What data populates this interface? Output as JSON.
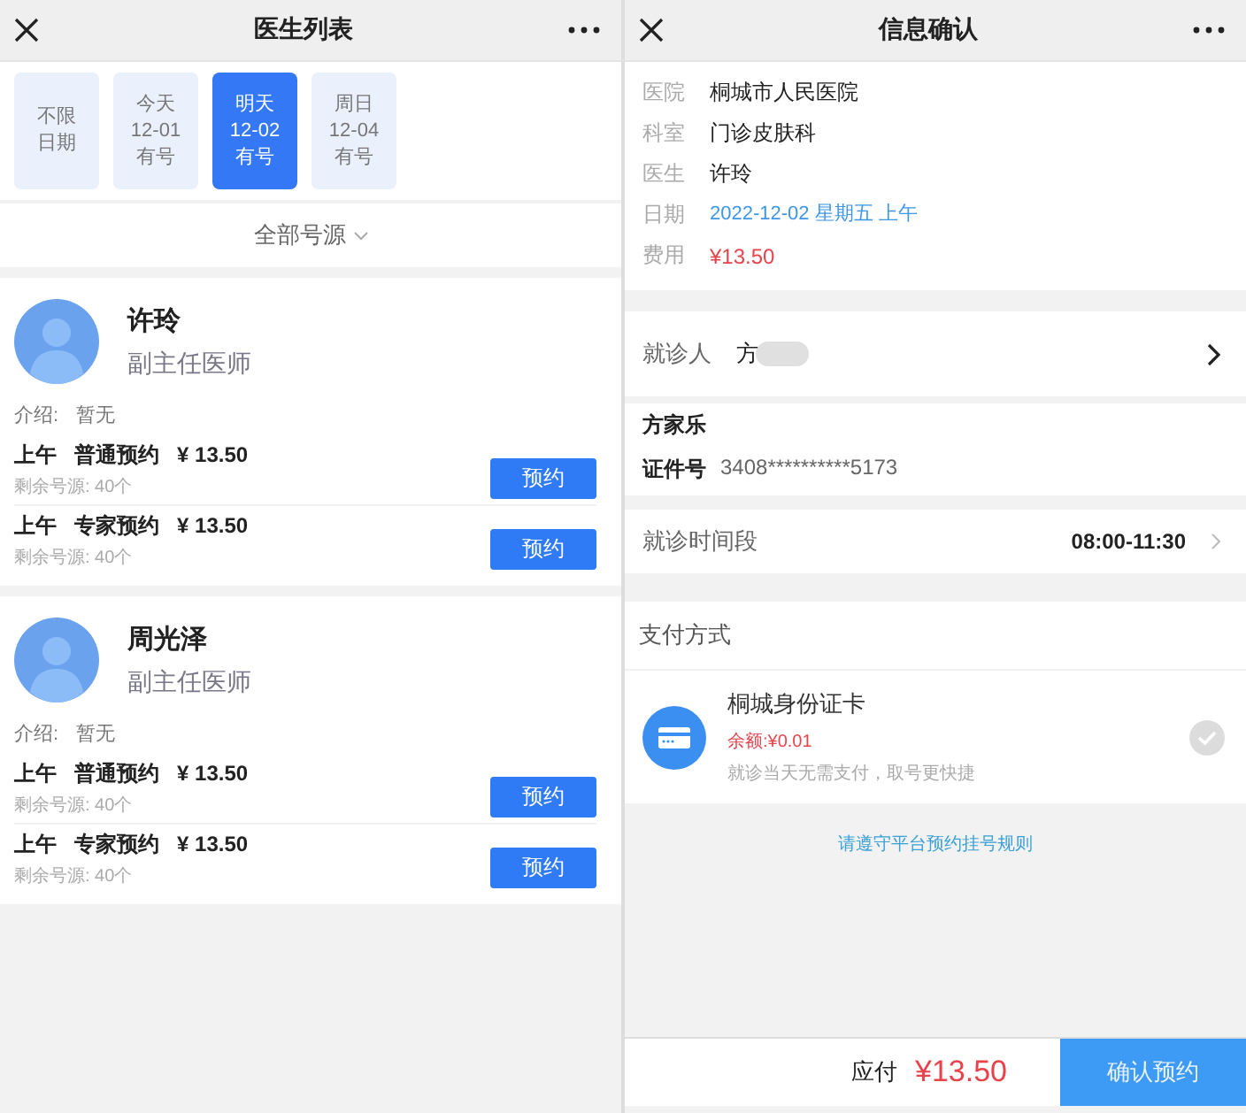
{
  "left": {
    "title": "医生列表",
    "dates": [
      {
        "lines": [
          "不限",
          "日期"
        ],
        "selected": false
      },
      {
        "lines": [
          "今天",
          "12-01",
          "有号"
        ],
        "selected": false
      },
      {
        "lines": [
          "明天",
          "12-02",
          "有号"
        ],
        "selected": true
      },
      {
        "lines": [
          "周日",
          "12-04",
          "有号"
        ],
        "selected": false
      }
    ],
    "filter": "全部号源",
    "doctors": [
      {
        "name": "许玲",
        "title": "副主任医师",
        "intro_label": "介绍:",
        "intro": "暂无",
        "slots": [
          {
            "period": "上午",
            "type": "普通预约",
            "price": "¥ 13.50",
            "remaining": "剩余号源: 40个",
            "button": "预约"
          },
          {
            "period": "上午",
            "type": "专家预约",
            "price": "¥ 13.50",
            "remaining": "剩余号源: 40个",
            "button": "预约"
          }
        ]
      },
      {
        "name": "周光泽",
        "title": "副主任医师",
        "intro_label": "介绍:",
        "intro": "暂无",
        "slots": [
          {
            "period": "上午",
            "type": "普通预约",
            "price": "¥ 13.50",
            "remaining": "剩余号源: 40个",
            "button": "预约"
          },
          {
            "period": "上午",
            "type": "专家预约",
            "price": "¥ 13.50",
            "remaining": "剩余号源: 40个",
            "button": "预约"
          }
        ]
      }
    ]
  },
  "right": {
    "title": "信息确认",
    "info": [
      {
        "label": "医院",
        "value": "桐城市人民医院",
        "kind": "plain"
      },
      {
        "label": "科室",
        "value": "门诊皮肤科",
        "kind": "plain"
      },
      {
        "label": "医生",
        "value": "许玲",
        "kind": "plain"
      },
      {
        "label": "日期",
        "value": "2022-12-02 星期五 上午",
        "kind": "date"
      },
      {
        "label": "费用",
        "value": "¥13.50",
        "kind": "price"
      }
    ],
    "patient": {
      "label": "就诊人",
      "value": "方",
      "name": "方家乐",
      "id_label": "证件号",
      "id": "3408**********5173"
    },
    "time": {
      "label": "就诊时间段",
      "value": "08:00-11:30"
    },
    "payment": {
      "heading": "支付方式",
      "methods": [
        {
          "name": "桐城身份证卡",
          "balance": "余额:¥0.01",
          "note": "就诊当天无需支付，取号更快捷",
          "selected": false
        }
      ]
    },
    "rules_link": "请遵守平台预约挂号规则",
    "footer": {
      "label": "应付",
      "amount": "¥13.50",
      "button": "确认预约"
    }
  }
}
